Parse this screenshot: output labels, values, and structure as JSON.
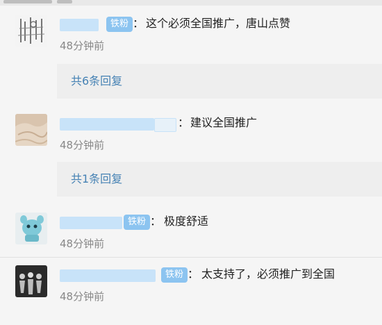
{
  "comments": [
    {
      "badge": "铁粉",
      "colon": "：",
      "text": "这个必须全国推广，唐山点赞",
      "time": "48分钟前",
      "avatar_icon": "sketch-art-avatar"
    },
    {
      "badge": "",
      "colon": "：",
      "text": "建议全国推广",
      "time": "48分钟前",
      "avatar_icon": "sand-texture-avatar"
    },
    {
      "badge": "铁粉",
      "colon": "：",
      "text": "极度舒适",
      "time": "48分钟前",
      "avatar_icon": "toy-figure-avatar"
    },
    {
      "badge": "铁粉",
      "colon": "：",
      "text": "太支持了，必须推广到全国",
      "time": "48分钟前",
      "avatar_icon": "dark-photo-avatar"
    }
  ],
  "replies": [
    {
      "label": "共6条回复"
    },
    {
      "label": "共1条回复"
    }
  ],
  "colors": {
    "background": "#f5f5f5",
    "reply_link": "#4682b4",
    "badge": "#8cc4f0",
    "timestamp": "#888888"
  }
}
